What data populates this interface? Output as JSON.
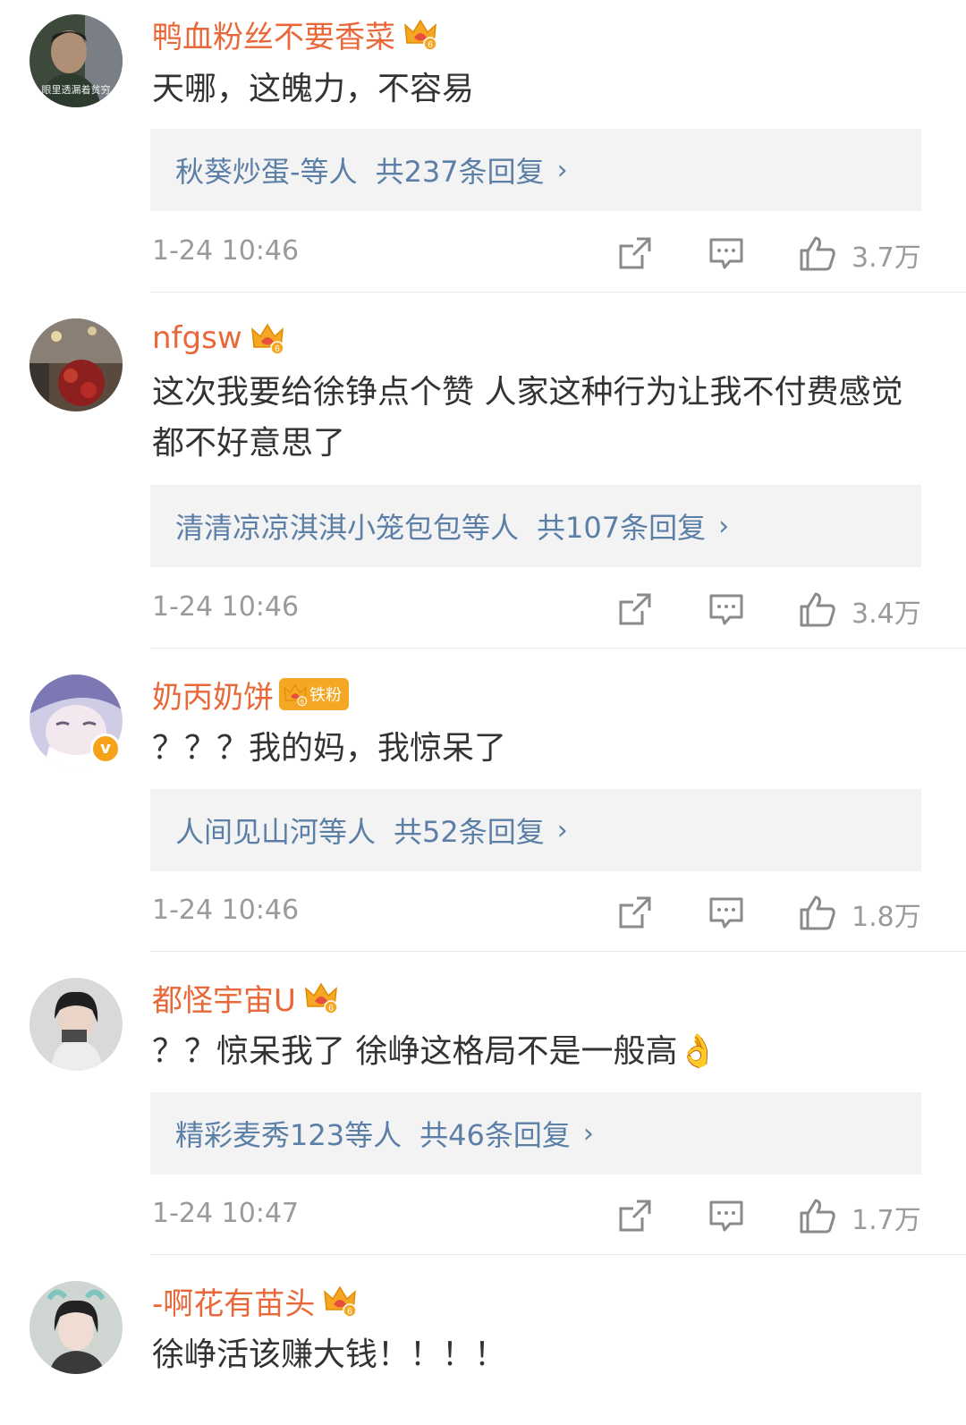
{
  "comments": [
    {
      "username": "鸭血粉丝不要香菜",
      "avatar_caption": "眼里透漏着贫穷",
      "text": "天哪，这魄力，不容易",
      "reply_users": "秋葵炒蛋-等人",
      "reply_count": "共237条回复",
      "time": "1-24 10:46",
      "likes": "3.7万"
    },
    {
      "username": "nfgsw",
      "text": "这次我要给徐铮点个赞 人家这种行为让我不付费感觉都不好意思了",
      "reply_users": "清清凉凉淇淇小笼包包等人",
      "reply_count": "共107条回复",
      "time": "1-24 10:46",
      "likes": "3.4万"
    },
    {
      "username": "奶丙奶饼",
      "fan_badge": "铁粉",
      "text": "？？？我的妈，我惊呆了",
      "reply_users": "人间见山河等人",
      "reply_count": "共52条回复",
      "time": "1-24 10:46",
      "likes": "1.8万"
    },
    {
      "username": "都怪宇宙U",
      "text": "？？惊呆我了 徐峥这格局不是一般高👌",
      "reply_users": "精彩麦秀123等人",
      "reply_count": "共46条回复",
      "time": "1-24 10:47",
      "likes": "1.7万"
    },
    {
      "username": "-啊花有苗头",
      "text": "徐峥活该赚大钱！！！！"
    }
  ],
  "chevron": "›",
  "verified_mark": "v",
  "icons": {
    "share": "share-icon",
    "reply": "comment-icon",
    "like": "thumbs-up-icon",
    "crown": "crown-badge-icon"
  },
  "colors": {
    "username": "#e9683a",
    "link": "#5b7fa6",
    "meta": "#9a9a9a",
    "reply_bg": "#f3f3f3"
  }
}
